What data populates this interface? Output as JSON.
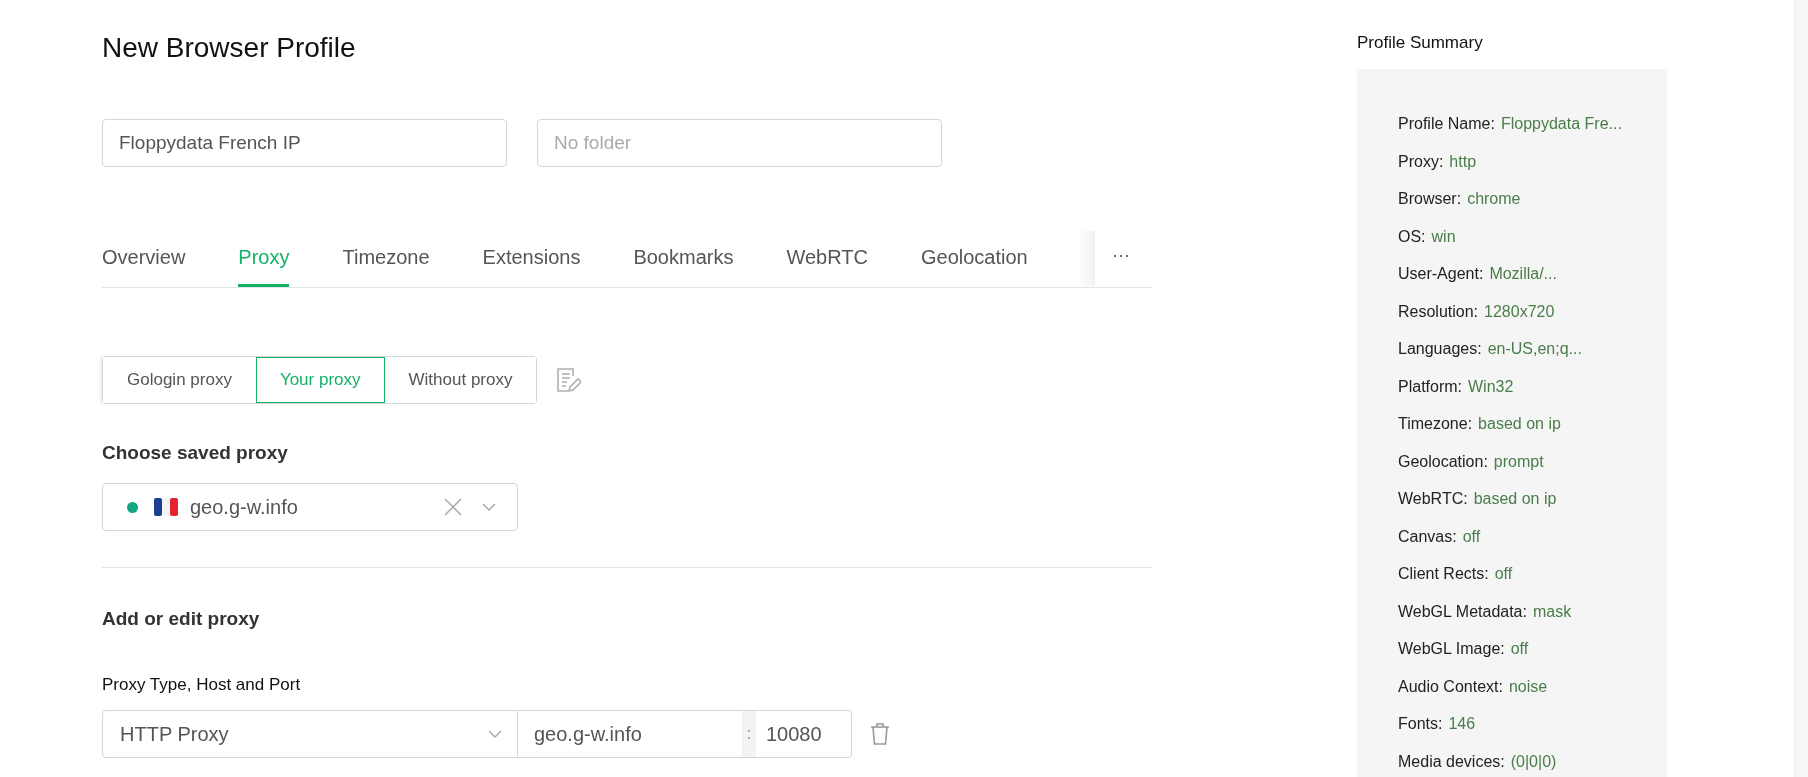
{
  "title": "New Browser Profile",
  "profile_name": {
    "value": "Floppydata French IP"
  },
  "folder": {
    "placeholder": "No folder"
  },
  "tabs": [
    {
      "label": "Overview",
      "selected": false
    },
    {
      "label": "Proxy",
      "selected": true
    },
    {
      "label": "Timezone",
      "selected": false
    },
    {
      "label": "Extensions",
      "selected": false
    },
    {
      "label": "Bookmarks",
      "selected": false
    },
    {
      "label": "WebRTC",
      "selected": false
    },
    {
      "label": "Geolocation",
      "selected": false
    }
  ],
  "more_tabs": "···",
  "proxy_modes": [
    {
      "label": "Gologin proxy",
      "selected": false
    },
    {
      "label": "Your proxy",
      "selected": true
    },
    {
      "label": "Without proxy",
      "selected": false
    }
  ],
  "saved_proxy": {
    "heading": "Choose saved proxy",
    "value": "geo.g-w.info",
    "color": "#13a683"
  },
  "edit_proxy": {
    "heading": "Add or edit proxy",
    "label": "Proxy Type, Host and Port",
    "type": "HTTP Proxy",
    "host": "geo.g-w.info",
    "separator": ":",
    "port": "10080"
  },
  "summary": {
    "title": "Profile Summary",
    "rows": [
      {
        "label": "Profile Name:",
        "value": "Floppydata Fre..."
      },
      {
        "label": "Proxy:",
        "value": "http"
      },
      {
        "label": "Browser:",
        "value": "chrome"
      },
      {
        "label": "OS:",
        "value": "win"
      },
      {
        "label": "User-Agent:",
        "value": "Mozilla/..."
      },
      {
        "label": "Resolution:",
        "value": "1280x720"
      },
      {
        "label": "Languages:",
        "value": "en-US,en;q..."
      },
      {
        "label": "Platform:",
        "value": "Win32"
      },
      {
        "label": "Timezone:",
        "value": "based on ip"
      },
      {
        "label": "Geolocation:",
        "value": "prompt"
      },
      {
        "label": "WebRTC:",
        "value": "based on ip"
      },
      {
        "label": "Canvas:",
        "value": "off"
      },
      {
        "label": "Client Rects:",
        "value": "off"
      },
      {
        "label": "WebGL Metadata:",
        "value": "mask"
      },
      {
        "label": "WebGL Image:",
        "value": "off"
      },
      {
        "label": "Audio Context:",
        "value": "noise"
      },
      {
        "label": "Fonts:",
        "value": "146"
      },
      {
        "label": "Media devices:",
        "value": "(0|0|0)"
      }
    ]
  }
}
